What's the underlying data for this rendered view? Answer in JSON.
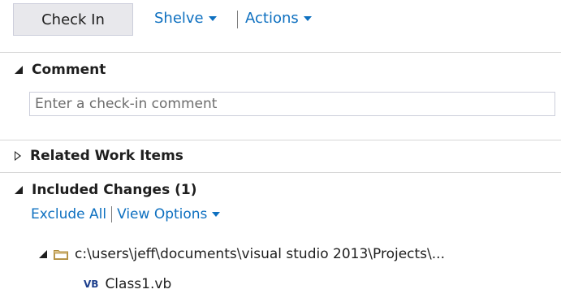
{
  "toolbar": {
    "check_in_label": "Check In",
    "shelve_label": "Shelve",
    "actions_label": "Actions"
  },
  "comment": {
    "heading": "Comment",
    "placeholder": "Enter a check-in comment"
  },
  "related_work_items": {
    "heading": "Related Work Items"
  },
  "included_changes": {
    "heading": "Included Changes (1)",
    "exclude_all_label": "Exclude All",
    "view_options_label": "View Options",
    "folder_path": "c:\\users\\jeff\\documents\\visual studio 2013\\Projects\\...",
    "file_type_badge": "VB",
    "file_name": "Class1.vb"
  },
  "colors": {
    "link": "#0e70c0",
    "button_bg": "#e8e8ec",
    "divider": "#d6d6d6",
    "folder": "#c5a96b",
    "vb_badge": "#1c3e8c"
  }
}
